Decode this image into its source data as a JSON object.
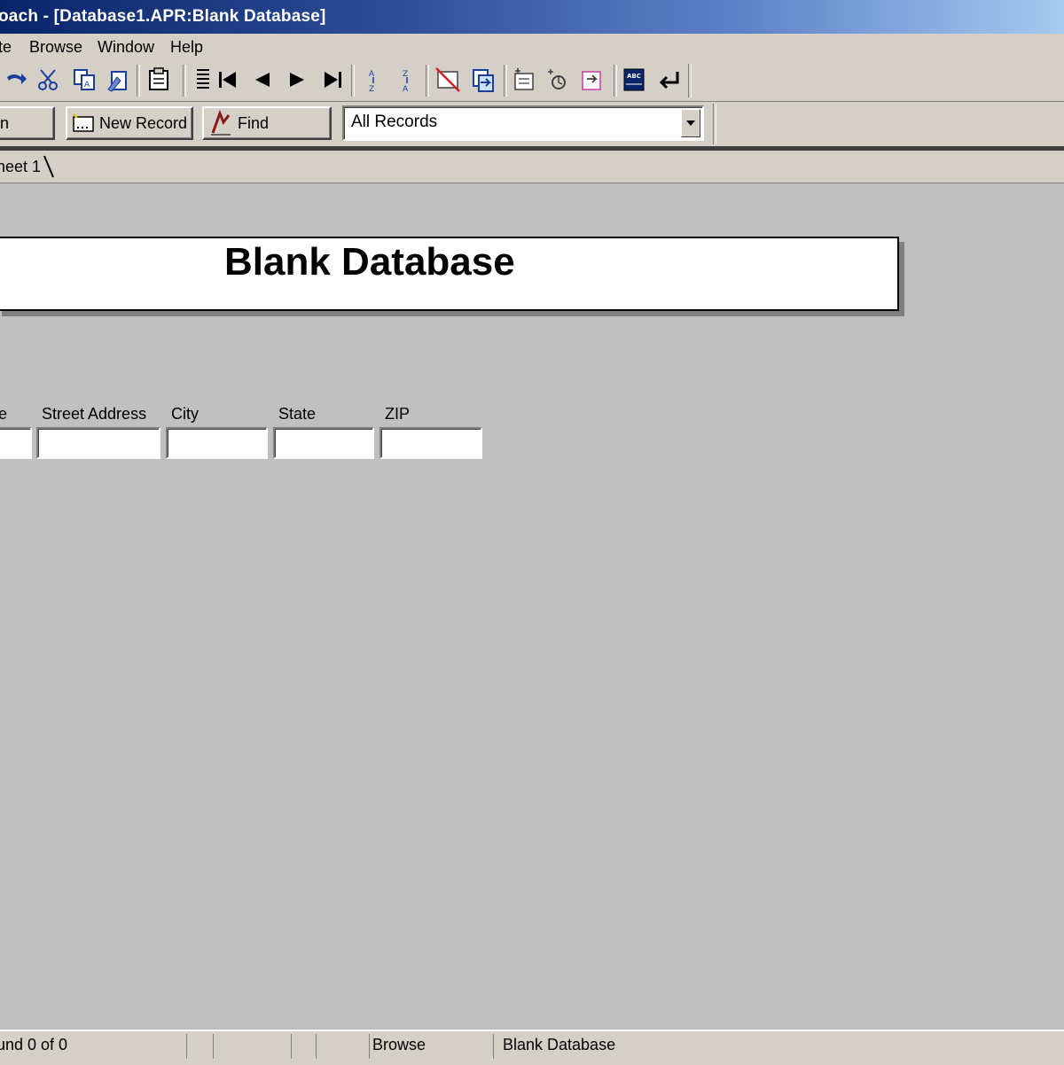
{
  "window": {
    "title": "oach - [Database1.APR:Blank Database]"
  },
  "menu": {
    "items": [
      {
        "label": "te",
        "left": "0"
      },
      {
        "label": "Browse"
      },
      {
        "label": "Window"
      },
      {
        "label": "Help"
      }
    ]
  },
  "toolbar": {
    "icons": [
      "redo-icon",
      "cut-icon",
      "copy-icon",
      "paste-format-icon",
      "paste-icon",
      "row-insert-icon",
      "first-record-icon",
      "previous-record-icon",
      "next-record-icon",
      "last-record-icon",
      "sort-ascending-icon",
      "sort-descending-icon",
      "delete-record-icon",
      "import-icon",
      "find-sort-icon",
      "refresh-icon",
      "rollover-icon",
      "spell-check-icon",
      "enter-icon"
    ]
  },
  "actions": {
    "partial_button_label": "n",
    "new_record_label": "New Record",
    "find_label": "Find",
    "records_select_value": "All Records"
  },
  "tabs": {
    "sheet_label": "heet 1"
  },
  "form": {
    "title": "Blank Database",
    "fields": [
      {
        "label": "e"
      },
      {
        "label": "Street Address"
      },
      {
        "label": "City"
      },
      {
        "label": "State"
      },
      {
        "label": "ZIP"
      }
    ]
  },
  "status": {
    "found": "und 0 of 0",
    "mode": "Browse",
    "view_name": "Blank Database"
  },
  "colors": {
    "title_gradient_start": "#0a246a",
    "title_gradient_end": "#a6caf0",
    "chrome": "#d4d0c8",
    "workspace": "#c0c0c0"
  }
}
